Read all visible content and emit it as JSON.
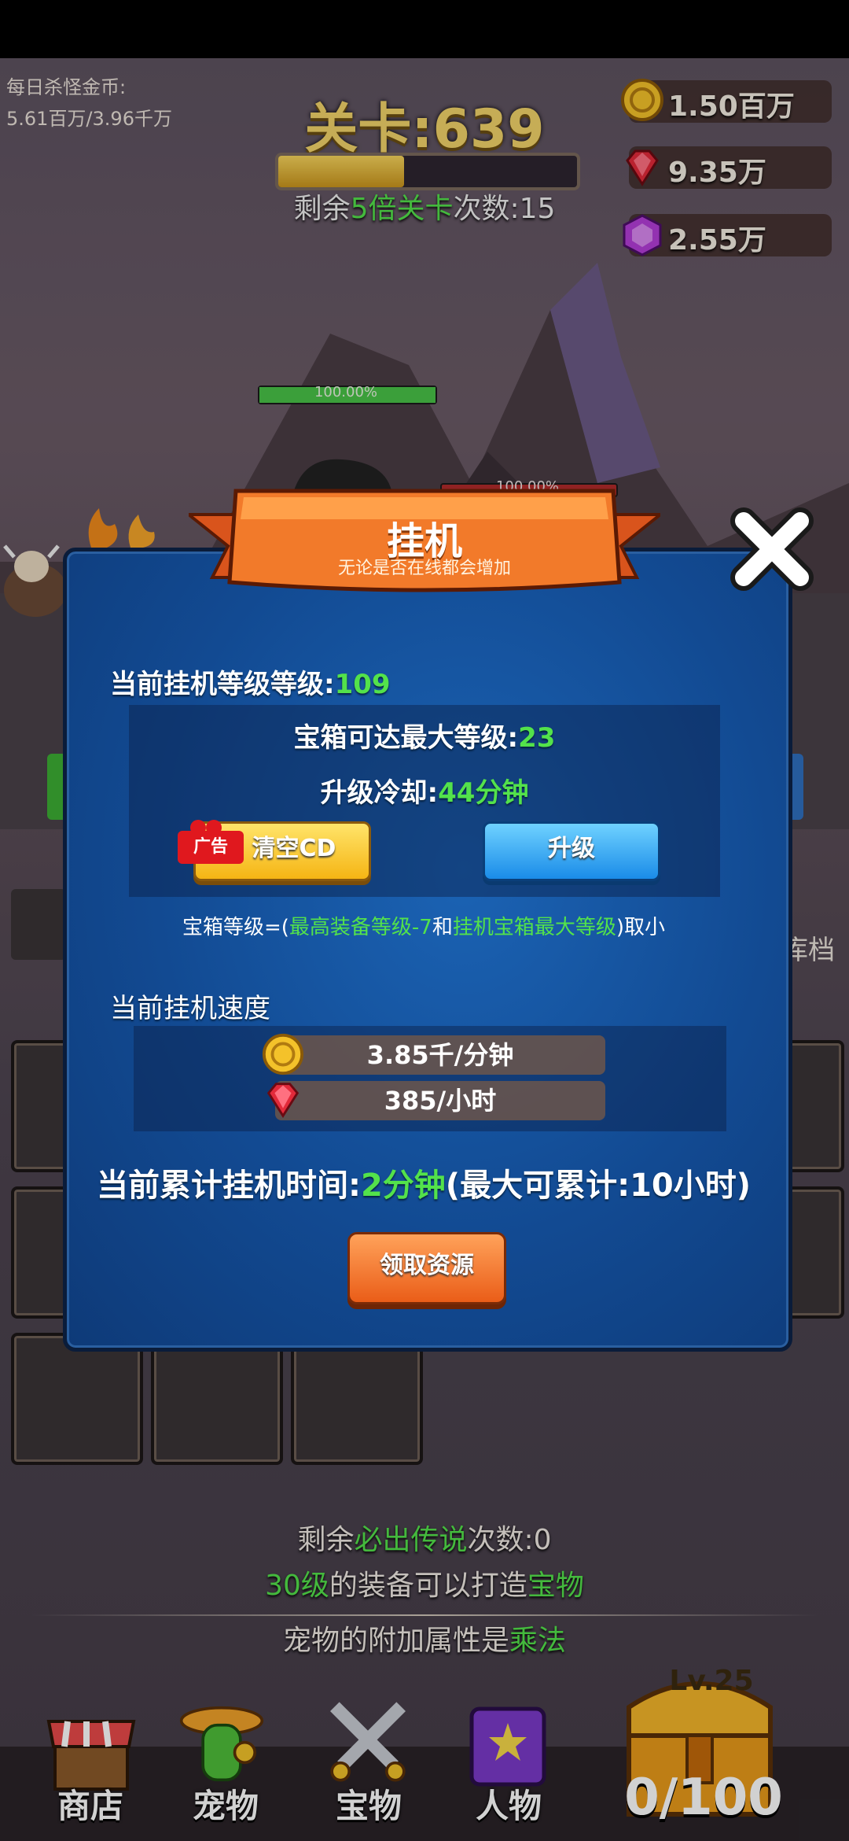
{
  "hud": {
    "daily_gold_label": "每日杀怪金币:",
    "daily_gold_value": "5.61百万/3.96千万",
    "level_title": "关卡:639",
    "level_progress": 0.42,
    "remain_prefix": "剩余",
    "remain_highlight": "5倍关卡",
    "remain_suffix": "次数:15"
  },
  "resources": [
    {
      "icon": "gold-coin-icon",
      "value": "1.50百万"
    },
    {
      "icon": "red-gem-icon",
      "value": "9.35万"
    },
    {
      "icon": "purple-gem-icon",
      "value": "2.55万"
    }
  ],
  "battle": {
    "hero_hp_text": "100.00%",
    "enemy_hp_text": "100.00%"
  },
  "dialog": {
    "title": "挂机",
    "subtitle": "无论是否在线都会增加",
    "level_label": "当前挂机等级等级:",
    "level_value": "109",
    "chest_max_label": "宝箱可达最大等级:",
    "chest_max_value": "23",
    "cooldown_label": "升级冷却:",
    "cooldown_value": "44分钟",
    "ad_tag": "广告",
    "clear_cd_label": "清空CD",
    "upgrade_label": "升级",
    "formula_prefix": "宝箱等级=(",
    "formula_part1": "最高装备等级-7",
    "formula_and": "和",
    "formula_part2": "挂机宝箱最大等级",
    "formula_suffix": ")取小",
    "speed_label": "当前挂机速度",
    "gold_rate": "3.85千/分钟",
    "gem_rate": "385/小时",
    "accum_prefix": "当前累计挂机时间:",
    "accum_value": "2分钟",
    "accum_suffix": "(最大可累计:10小时)",
    "claim_label": "领取资源"
  },
  "side_fragment": "库档",
  "tips": {
    "legend_prefix": "剩余",
    "legend_highlight": "必出传说",
    "legend_suffix": "次数:0",
    "craft_highlight1": "30级",
    "craft_mid": "的装备可以打造",
    "craft_highlight2": "宝物",
    "pet_prefix": "宠物的附加属性是",
    "pet_highlight": "乘法"
  },
  "nav": [
    {
      "label": "商店",
      "icon": "shop-stall-icon"
    },
    {
      "label": "宠物",
      "icon": "cactus-pet-icon"
    },
    {
      "label": "宝物",
      "icon": "crossed-swords-icon"
    },
    {
      "label": "人物",
      "icon": "spellbook-icon"
    }
  ],
  "chest": {
    "level": "Lv.25",
    "count": "0/100",
    "icon": "treasure-chest-icon"
  },
  "colors": {
    "highlight_green": "#53e24b",
    "dialog_blue": "#124a92",
    "gold": "#f2d46a"
  }
}
